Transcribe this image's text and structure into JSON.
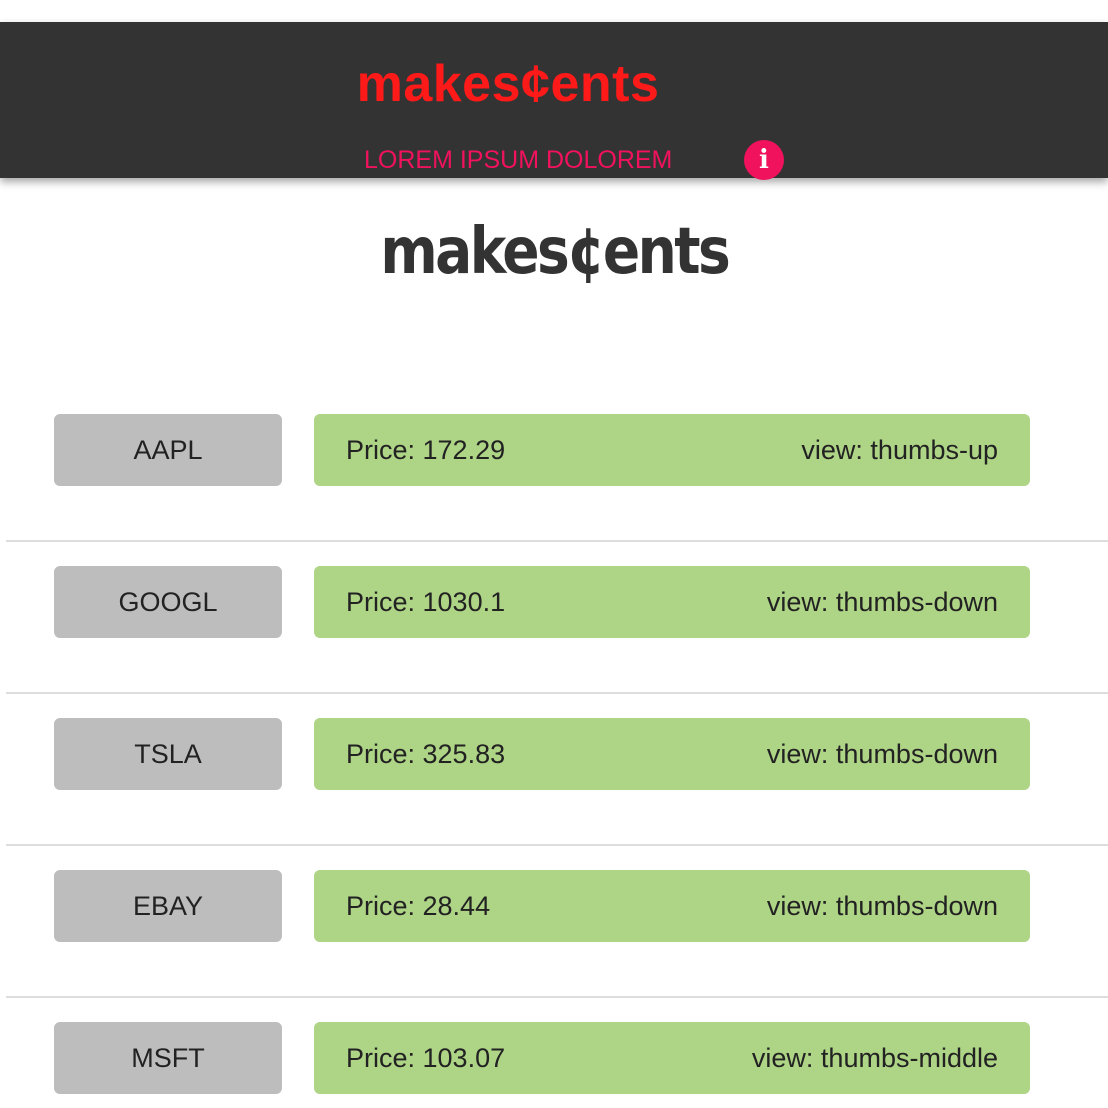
{
  "header": {
    "logo": "makes¢ents",
    "nav_link": "LOREM IPSUM DOLOREM",
    "info_icon": "info-icon",
    "info_glyph": "i"
  },
  "main": {
    "title": "makes¢ents"
  },
  "stocks": [
    {
      "symbol": "AAPL",
      "price": "Price: 172.29",
      "view": "view: thumbs-up"
    },
    {
      "symbol": "GOOGL",
      "price": "Price: 1030.1",
      "view": "view: thumbs-down"
    },
    {
      "symbol": "TSLA",
      "price": "Price: 325.83",
      "view": "view: thumbs-down"
    },
    {
      "symbol": "EBAY",
      "price": "Price: 28.44",
      "view": "view: thumbs-down"
    },
    {
      "symbol": "MSFT",
      "price": "Price: 103.07",
      "view": "view: thumbs-middle"
    }
  ],
  "colors": {
    "header_bg": "#333333",
    "logo": "#ff1a1a",
    "accent": "#f0125d",
    "title": "#333333",
    "symbol_bg": "#bdbdbd",
    "card_bg": "#aed486"
  }
}
